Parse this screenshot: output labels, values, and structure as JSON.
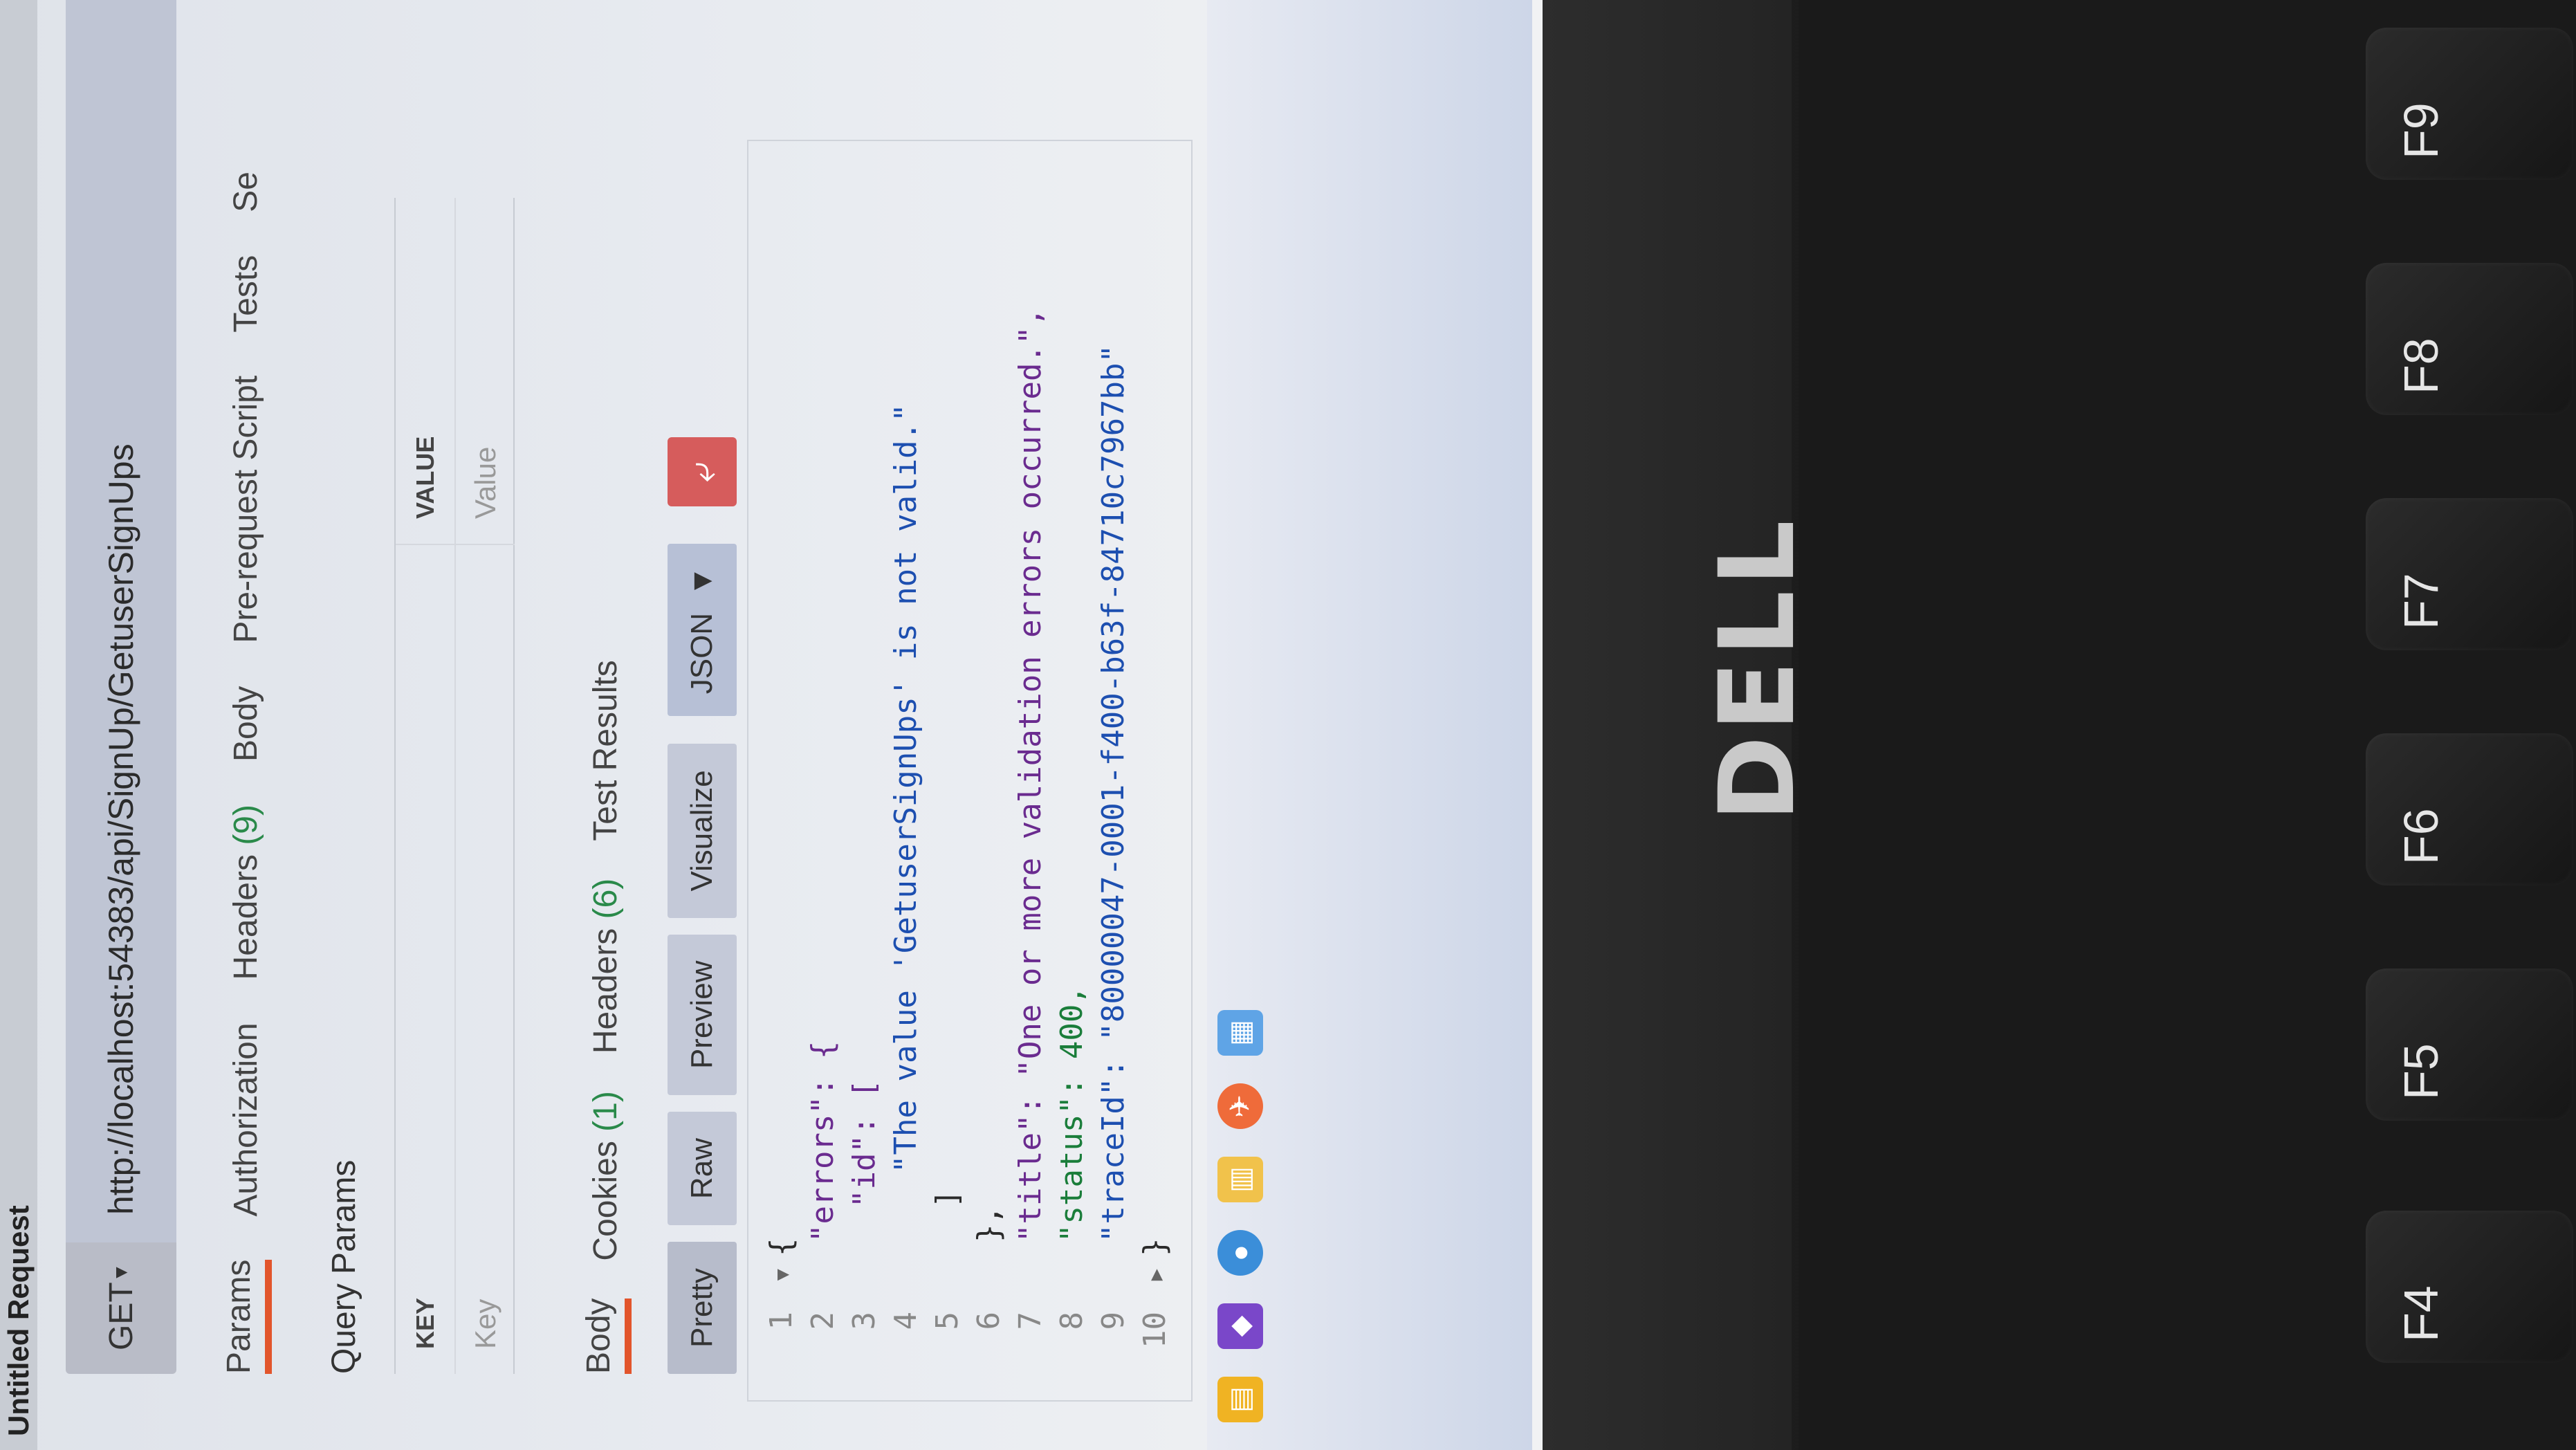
{
  "window": {
    "title": "Untitled Request"
  },
  "request": {
    "method": "GET",
    "url": "http://localhost:54383/api/SignUp/GetuserSignUps",
    "tabs": [
      {
        "label": "Params",
        "active": true
      },
      {
        "label": "Authorization"
      },
      {
        "label": "Headers",
        "count": "(9)"
      },
      {
        "label": "Body"
      },
      {
        "label": "Pre-request Script"
      },
      {
        "label": "Tests"
      },
      {
        "label": "Se"
      }
    ]
  },
  "query_params": {
    "title": "Query Params",
    "col_key": "KEY",
    "col_value": "VALUE",
    "key_placeholder": "Key",
    "value_placeholder": "Value"
  },
  "response": {
    "tabs": [
      {
        "label": "Body",
        "active": true
      },
      {
        "label": "Cookies",
        "count": "(1)"
      },
      {
        "label": "Headers",
        "count": "(6)"
      },
      {
        "label": "Test Results"
      }
    ],
    "view_modes": [
      "Pretty",
      "Raw",
      "Preview",
      "Visualize"
    ],
    "format": "JSON",
    "wrap_icon": "wrap-lines-icon"
  },
  "code": [
    {
      "n": "1",
      "text": "{"
    },
    {
      "n": "2",
      "text": "\"errors\": {"
    },
    {
      "n": "3",
      "text": "\"id\": ["
    },
    {
      "n": "4",
      "text": "\"The value 'GetuserSignUps' is not valid.\""
    },
    {
      "n": "5",
      "text": "]"
    },
    {
      "n": "6",
      "text": "},"
    },
    {
      "n": "7",
      "text": "\"title\": \"One or more validation errors occurred.\","
    },
    {
      "n": "8",
      "text": "\"status\": 400,"
    },
    {
      "n": "9",
      "text": "\"traceId\": \"80000047-0001-f400-b63f-84710c7967bb\""
    },
    {
      "n": "10",
      "text": "}"
    }
  ],
  "taskbar": {
    "icons": [
      "folder-icon",
      "vs-icon",
      "chrome-icon",
      "files-icon",
      "postman-icon",
      "notes-icon"
    ]
  },
  "laptop": {
    "brand": "DELL",
    "keys": [
      "F4",
      "F5",
      "F6",
      "F7",
      "F8",
      "F9"
    ]
  }
}
